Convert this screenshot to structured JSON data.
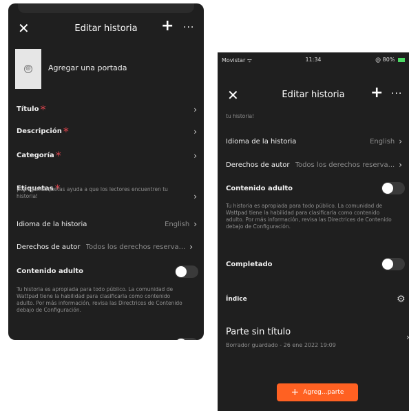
{
  "left": {
    "header": {
      "title": "Editar historia",
      "close": "✕",
      "add": "+",
      "more": "···"
    },
    "cover": {
      "icon": "⊕",
      "label": "Agregar una portada"
    },
    "rows": {
      "titulo": {
        "label": "Título",
        "req": "*"
      },
      "descripcion": {
        "label": "Descripción",
        "req": "*"
      },
      "categoria": {
        "label": "Categoría",
        "req": "*"
      },
      "etiquetas": {
        "label": "Etiquetas",
        "req": "*",
        "hint": "¡Agregar etiquetas ayuda a que los lectores encuentren tu historia!"
      },
      "idioma": {
        "label": "Idioma de la historia",
        "value": "English"
      },
      "derechos": {
        "label": "Derechos de autor",
        "value": "Todos los derechos reserva..."
      },
      "adulto": {
        "label": "Contenido adulto",
        "hint": "Tu historia es apropiada para todo público. La comunidad de Wattpad tiene la habilidad para clasificarla como contenido adulto. Por más información, revisa las Directrices de Contenido debajo de Configuración."
      }
    },
    "chevron": "›"
  },
  "right": {
    "status": {
      "carrier": "Movistar",
      "wifi": "ᯤ",
      "time": "11:34",
      "battery": "80%",
      "nfc": "@"
    },
    "header": {
      "title": "Editar historia",
      "close": "✕",
      "add": "+",
      "more": "···"
    },
    "top_hint": "tu historia!",
    "rows": {
      "idioma": {
        "label": "Idioma de la historia",
        "value": "English"
      },
      "derechos": {
        "label": "Derechos de autor",
        "value": "Todos los derechos reserva..."
      },
      "adulto": {
        "label": "Contenido adulto",
        "hint": "Tu historia es apropiada para todo público. La comunidad de Wattpad tiene la habilidad para clasificarla como contenido adulto. Por más información, revisa las Directrices de Contenido debajo de Configuración."
      },
      "completado": {
        "label": "Completado"
      },
      "indice": {
        "label": "Índice",
        "icon": "⚙"
      }
    },
    "part": {
      "title": "Parte sin título",
      "subtitle": "Borrador guardado - 26 ene 2022 19:09"
    },
    "add_button": {
      "plus": "+",
      "label": "Agreg...parte"
    },
    "chevron": "›"
  },
  "colors": {
    "background": "#1f1f1f",
    "accent": "#ff6122",
    "required": "#e0454e"
  },
  "toggles": {
    "left_adulto": false,
    "right_adulto": false,
    "right_completado": false
  }
}
